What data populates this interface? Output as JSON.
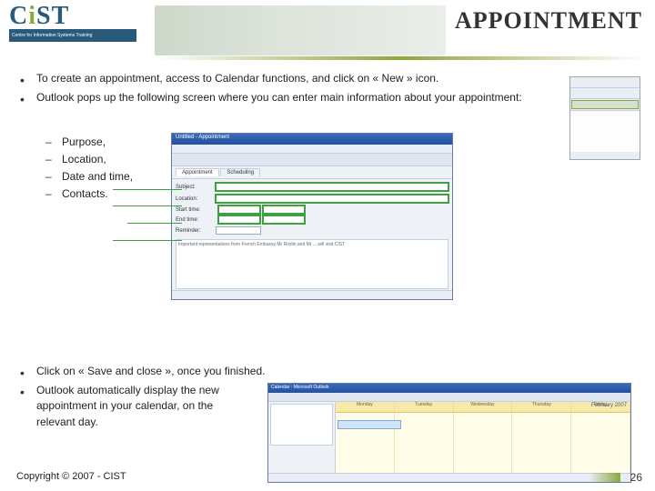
{
  "header": {
    "logo_text_main": "CIST",
    "logo_bar_text": "Centre for    Information Systems Training",
    "title": "APPOINTMENT"
  },
  "bullets": {
    "b1": "To create an appointment, access to Calendar functions, and click on « New » icon.",
    "b2": "Outlook pops up the following screen where you can enter main information about your appointment:",
    "sub": {
      "s1": "Purpose,",
      "s2": "Location,",
      "s3": "Date and time,",
      "s4": "Contacts."
    },
    "b3": "Click on « Save and close », once you finished.",
    "b4": "Outlook automatically display the new appointment in your calendar, on the relevant day."
  },
  "form": {
    "tab1": "Appointment",
    "tab2": "Scheduling",
    "subject_lbl": "Subject:",
    "location_lbl": "Location:",
    "start_lbl": "Start time:",
    "end_lbl": "End time:",
    "reminder_lbl": "Reminder:",
    "body_hint": "Important representatives from French Embassy Mr Roslin and Mr ... will visit CIST"
  },
  "calendar": {
    "title": "Calendar - Microsoft Outlook",
    "month": "February 2007",
    "days": [
      "Monday",
      "Tuesday",
      "Wednesday",
      "Thursday",
      "Friday"
    ]
  },
  "footer": {
    "copyright": "Copyright © 2007 - CIST",
    "page": "26"
  }
}
